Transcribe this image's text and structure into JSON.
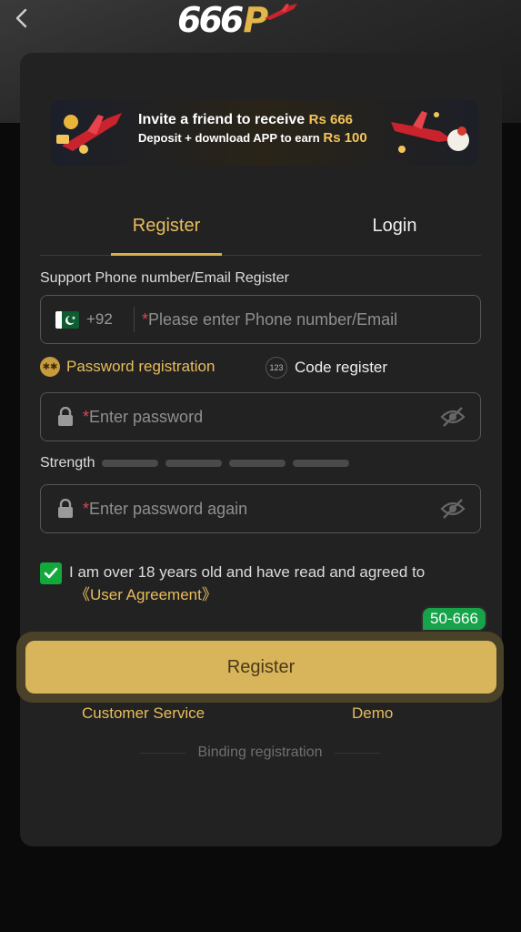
{
  "header": {
    "logo_number": "666",
    "logo_letter": "P"
  },
  "banner": {
    "line1_text": "Invite a friend to receive",
    "line1_amount": "Rs 666",
    "line2_text": "Deposit + download APP to earn",
    "line2_amount": "Rs 100"
  },
  "tabs": [
    {
      "label": "Register",
      "active": true
    },
    {
      "label": "Login",
      "active": false
    }
  ],
  "form": {
    "support_label": "Support Phone number/Email Register",
    "country_code": "+92",
    "phone_placeholder": "Please enter Phone number/Email",
    "required_marker": "*",
    "option_password": "Password registration",
    "option_code": "Code register",
    "option_code_icon": "123",
    "password_placeholder": "Enter password",
    "strength_label": "Strength",
    "strength_level": 0,
    "strength_segments": 4,
    "confirm_placeholder": "Enter password again",
    "agree_text": "I am over 18 years old and have read and agreed to",
    "agree_link": "《User Agreement》",
    "agree_checked": true
  },
  "promo_badge": "50-666",
  "register_button": "Register",
  "links": {
    "customer_service": "Customer Service",
    "demo": "Demo",
    "binding": "Binding registration"
  },
  "colors": {
    "accent_gold": "#e8bd5c",
    "button_gold": "#d8b45b",
    "check_green": "#13a83c",
    "required_red": "#e0455a"
  }
}
